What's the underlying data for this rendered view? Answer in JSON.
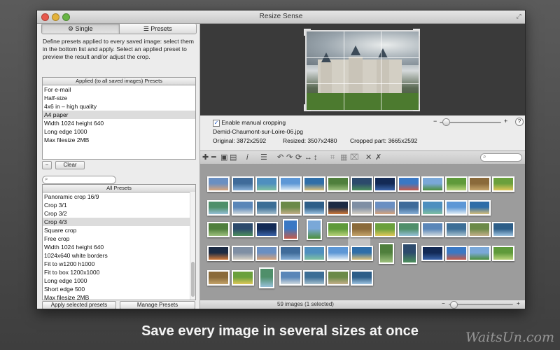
{
  "window": {
    "title": "Resize Sense"
  },
  "tabs": [
    {
      "icon": "gear-icon",
      "label": "Single"
    },
    {
      "icon": "list-icon",
      "label": "Presets"
    }
  ],
  "left": {
    "description": "Define presets applied to every saved image: select them in the bottom list and apply.  Select an applied preset to preview the result and/or adjust the crop.",
    "applied_header": "Applied (to all saved images) Presets",
    "applied_items": [
      "For e-mail",
      "Half-size",
      "4x6 in – high quality",
      "A4 paper",
      "Width 1024 height 640",
      "Long edge 1000",
      "Max filesize 2MB"
    ],
    "applied_selected_index": 3,
    "remove_label": "−",
    "clear_label": "Clear",
    "search_placeholder": "",
    "all_header": "All Presets",
    "all_items": [
      "Panoramic crop 16/9",
      "Crop 3/1",
      "Crop 3/2",
      "Crop 4/3",
      "Square crop",
      "Free crop",
      "Width 1024 height 640",
      "1024x640 white borders",
      "Fit to w1200 h1000",
      "Fit to box 1200x1000",
      "Long edge 1000",
      "Short edge 500",
      "Max filesize 2MB"
    ],
    "all_selected_index": 3,
    "apply_label": "Apply selected presets",
    "manage_label": "Manage Presets"
  },
  "info": {
    "manual_crop_label": "Enable manual cropping",
    "manual_crop_checked": true,
    "filename": "Demid-Chaumont-sur-Loire-06.jpg",
    "original": "Original: 3872x2592",
    "resized": "Resized: 3507x2480",
    "cropped": "Cropped part: 3665x2592",
    "zoom_minus": "−",
    "zoom_plus": "+",
    "zoom_level": 0.1,
    "help": "?"
  },
  "toolbar": {
    "icons": [
      "add-icon",
      "remove-icon",
      "save-icon",
      "export-icon",
      "info-icon",
      "list-icon",
      "rotate-left-icon",
      "rotate-right-icon",
      "rotate-icon",
      "flip-horizontal-icon",
      "flip-vertical-icon",
      "crop-icon",
      "filter-icon",
      "stamp-icon",
      "close-icon",
      "collapse-icon"
    ],
    "search_placeholder": ""
  },
  "status": {
    "text": "59 images (1 selected)",
    "minus": "−",
    "plus": "+",
    "thumb_size": 0.08
  },
  "caption": "Save every image in several sizes at once",
  "watermark": "WaitsUn.com",
  "colors": {
    "selection": "#dcdcdc",
    "gallery_bg": "#9c9c9c",
    "preview_bg": "#3a3a3a"
  }
}
